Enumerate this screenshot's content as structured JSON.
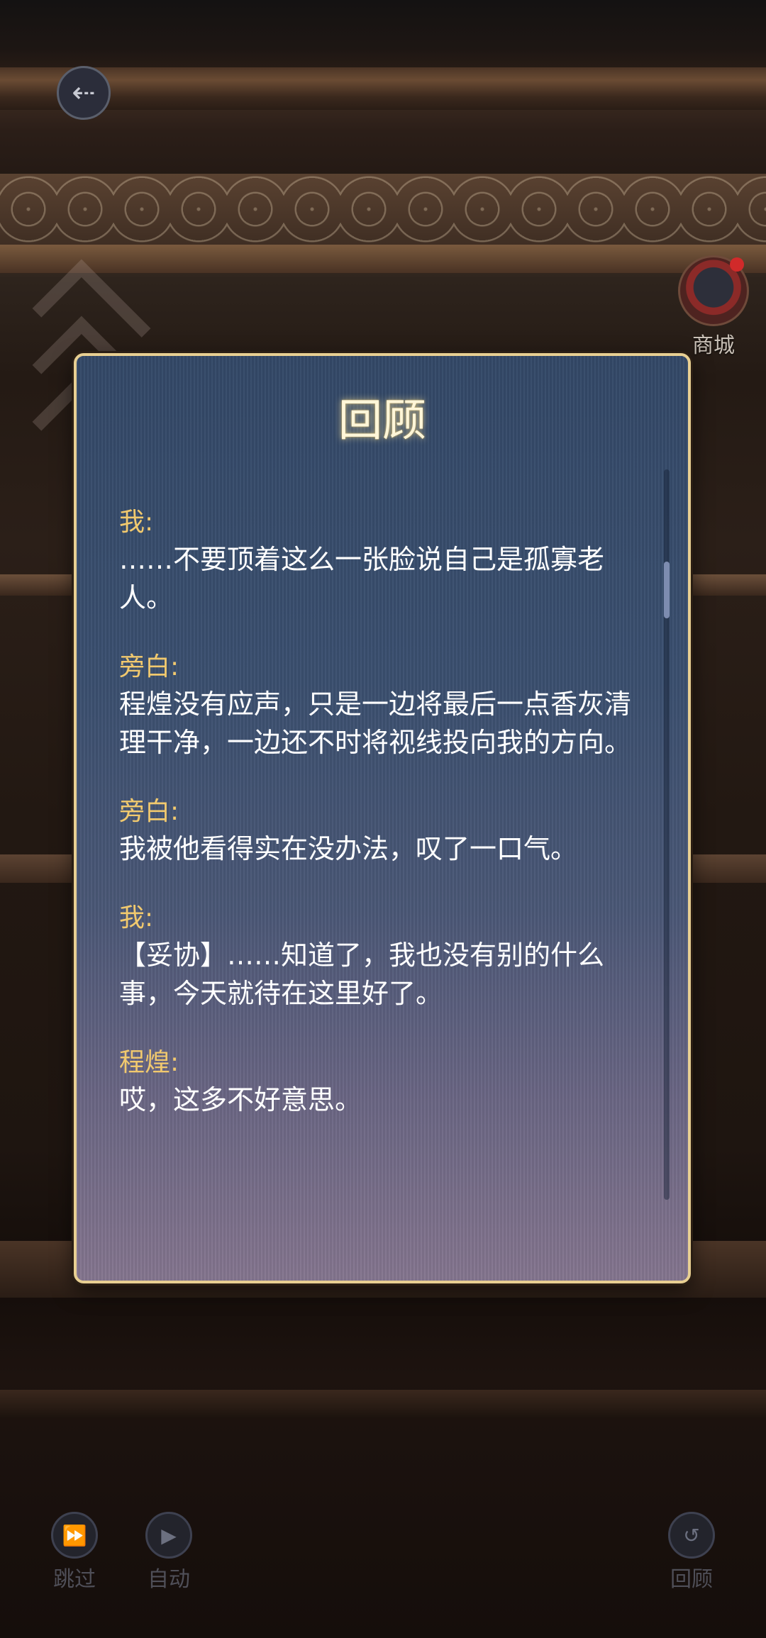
{
  "header": {
    "back_icon": "back-arrow-icon",
    "shop_label": "商城"
  },
  "panel": {
    "title": "回顾",
    "entries": [
      {
        "speaker": "我:",
        "text": "……不要顶着这么一张脸说自己是孤寡老人。"
      },
      {
        "speaker": "旁白:",
        "text": "程煌没有应声，只是一边将最后一点香灰清理干净，一边还不时将视线投向我的方向。"
      },
      {
        "speaker": "旁白:",
        "text": "我被他看得实在没办法，叹了一口气。"
      },
      {
        "speaker": "我:",
        "text": "【妥协】……知道了，我也没有别的什么事，今天就待在这里好了。"
      },
      {
        "speaker": "程煌:",
        "text": "哎，这多不好意思。"
      }
    ]
  },
  "controls": {
    "skip_label": "跳过",
    "auto_label": "自动",
    "review_label": "回顾"
  },
  "colors": {
    "panel_border": "#e8cf92",
    "speaker": "#f1c96e",
    "text": "#ffffff"
  }
}
